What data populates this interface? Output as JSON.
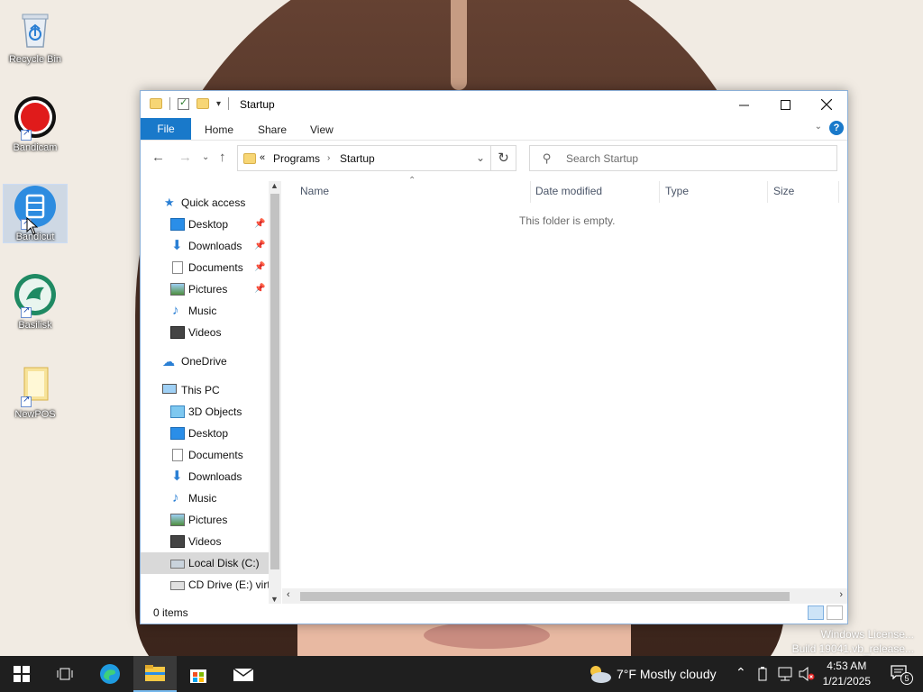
{
  "desktop": {
    "icons": [
      {
        "label": "Recycle Bin",
        "icon": "recycle-bin-icon"
      },
      {
        "label": "Bandicam",
        "icon": "bandicam-icon"
      },
      {
        "label": "Bandicut",
        "icon": "bandicut-icon"
      },
      {
        "label": "Basilisk",
        "icon": "basilisk-icon"
      },
      {
        "label": "NewPOS",
        "icon": "folder-icon"
      }
    ]
  },
  "window": {
    "title": "Startup",
    "ribbon_tabs": [
      "File",
      "Home",
      "Share",
      "View"
    ],
    "help_label": "?",
    "address": {
      "overflow": "«",
      "crumbs": [
        "Programs",
        "Startup"
      ]
    },
    "search_placeholder": "Search Startup",
    "nav": {
      "quick_access": "Quick access",
      "quick_items": [
        "Desktop",
        "Downloads",
        "Documents",
        "Pictures",
        "Music",
        "Videos"
      ],
      "onedrive": "OneDrive",
      "this_pc": "This PC",
      "pc_items": [
        "3D Objects",
        "Desktop",
        "Documents",
        "Downloads",
        "Music",
        "Pictures",
        "Videos",
        "Local Disk (C:)",
        "CD Drive (E:) virt"
      ],
      "selected": "Local Disk (C:)"
    },
    "columns": [
      "Name",
      "Date modified",
      "Type",
      "Size"
    ],
    "empty_message": "This folder is empty.",
    "status": "0 items"
  },
  "watermark": {
    "line1": "Windows License...",
    "line2": "Build 19041.vb_release..."
  },
  "taskbar": {
    "weather": "7°F  Mostly cloudy",
    "time": "4:53 AM",
    "date": "1/21/2025",
    "notifications": "5"
  },
  "colors": {
    "accent": "#1979ca",
    "taskbar": "#1f1f1f",
    "selection": "#d9d9d9"
  }
}
